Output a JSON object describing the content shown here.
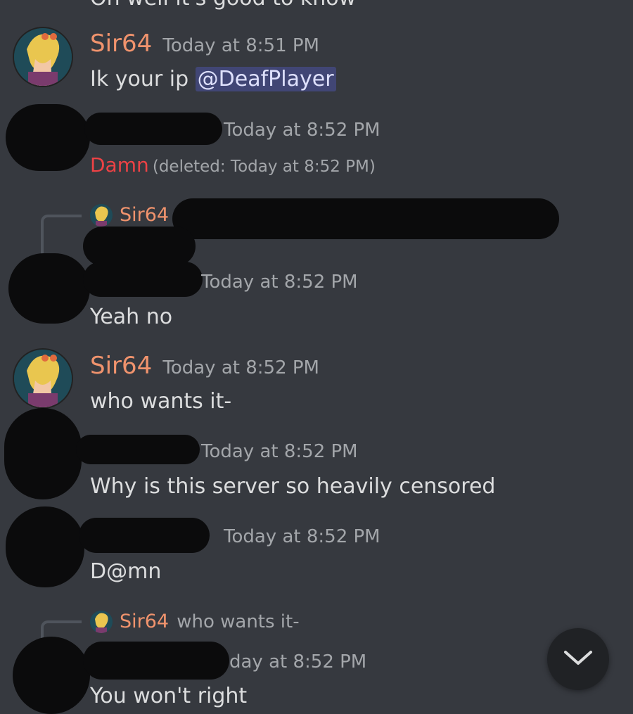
{
  "top_cut_text": "Oh well it's good to know",
  "messages": {
    "m1": {
      "author": "Sir64",
      "time": "Today at 8:51 PM",
      "text": "Ik your ip ",
      "mention": "@DeafPlayer"
    },
    "m2": {
      "time": "Today at 8:52 PM",
      "deleted_text": "Damn",
      "deleted_note": "(deleted: Today at 8:52 PM)"
    },
    "m3": {
      "reply_author": "Sir64",
      "time": "Today at 8:52 PM",
      "text": "Yeah no"
    },
    "m4": {
      "author": "Sir64",
      "time": "Today at 8:52 PM",
      "text": "who wants it-"
    },
    "m5": {
      "time": "Today at 8:52 PM",
      "text": "Why is this server so heavily censored"
    },
    "m6": {
      "time": "Today at 8:52 PM",
      "text": "D@mn"
    },
    "m7": {
      "reply_author": "Sir64",
      "reply_text": "who wants it-",
      "time": "day at 8:52 PM",
      "text": "You won't right"
    }
  },
  "icons": {
    "scroll_down": "chevron-down-icon",
    "avatar": "avatar"
  }
}
